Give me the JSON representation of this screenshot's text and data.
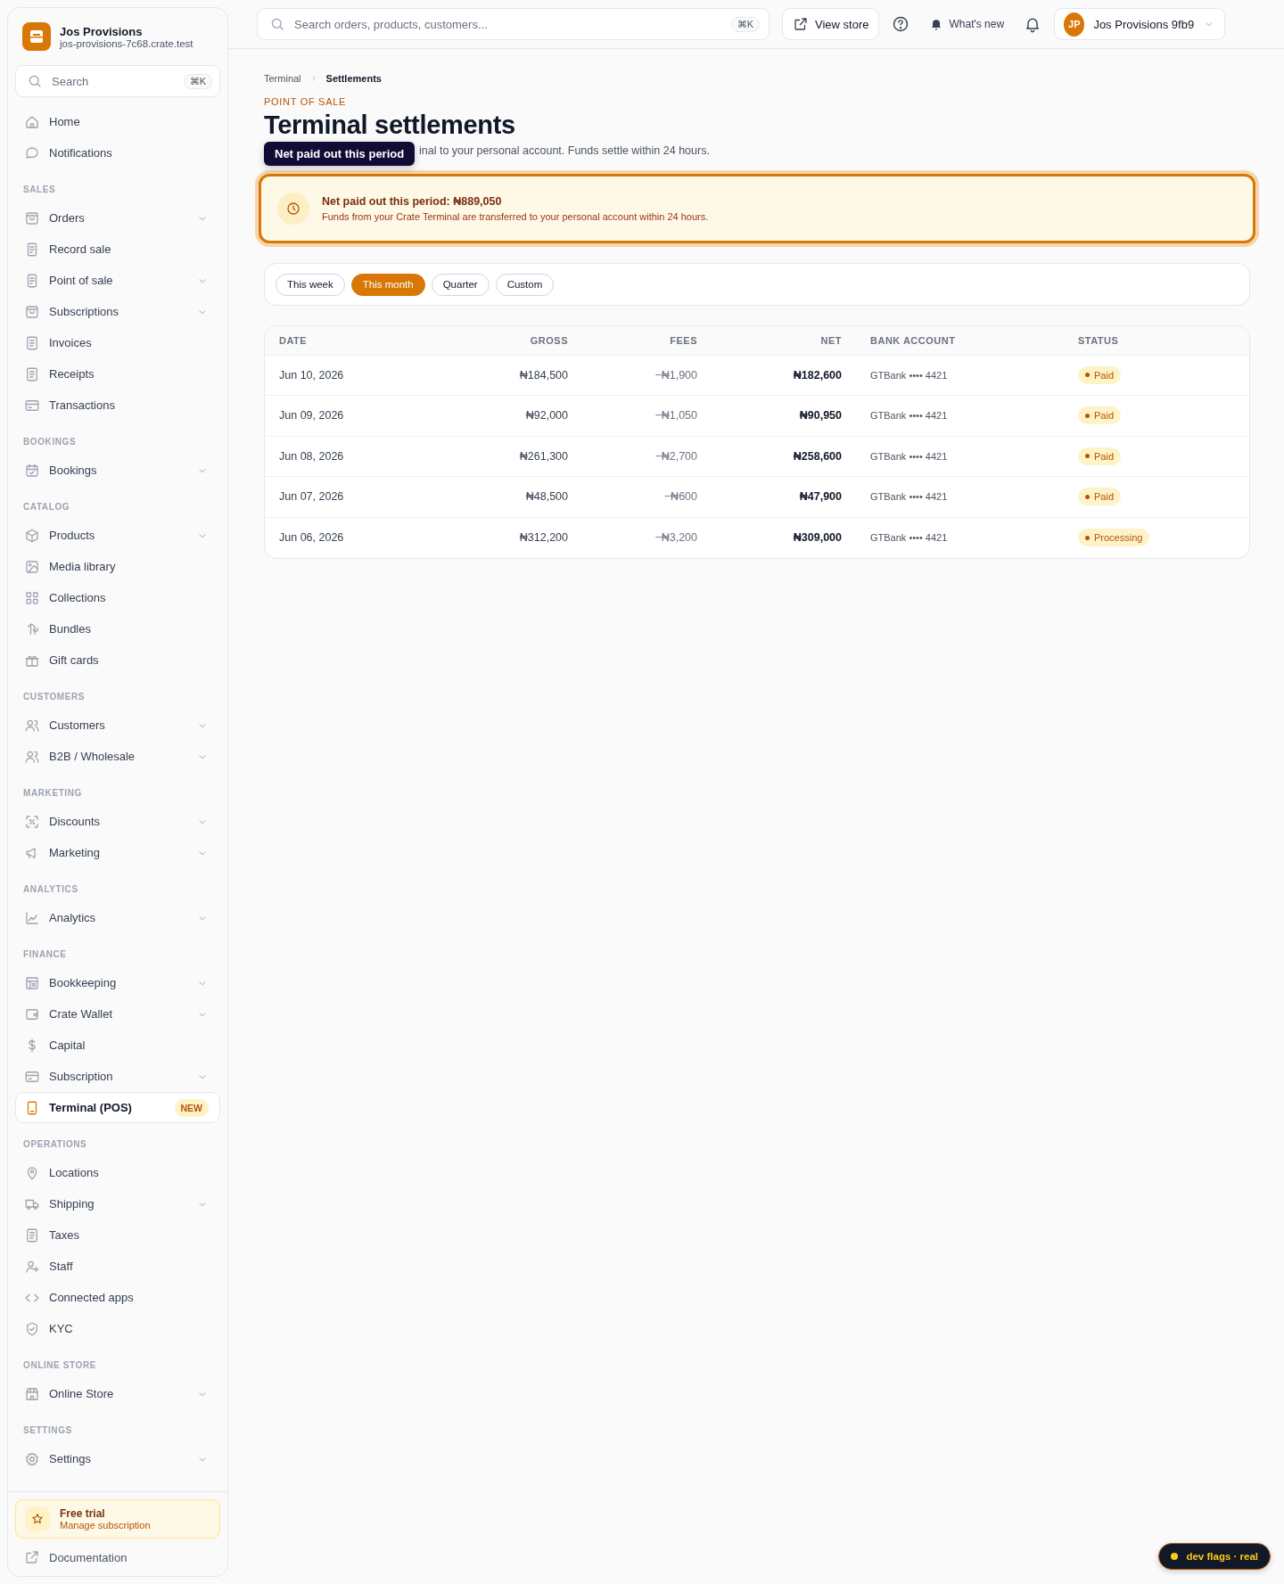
{
  "brand": {
    "name": "Jos Provisions",
    "domain": "jos-provisions-7c68.crate.test"
  },
  "sidebar_search": {
    "placeholder": "Search",
    "shortcut": "⌘K"
  },
  "sidebar": {
    "sections": [
      {
        "items": [
          {
            "label": "Home",
            "expandable": false,
            "selected": false
          },
          {
            "label": "Notifications",
            "expandable": false,
            "selected": false
          }
        ]
      },
      {
        "label": "SALES",
        "items": [
          {
            "label": "Orders",
            "expandable": true,
            "selected": false
          },
          {
            "label": "Record sale",
            "expandable": false,
            "selected": false
          },
          {
            "label": "Point of sale",
            "expandable": true,
            "selected": false
          },
          {
            "label": "Subscriptions",
            "expandable": true,
            "selected": false
          },
          {
            "label": "Invoices",
            "expandable": false,
            "selected": false
          },
          {
            "label": "Receipts",
            "expandable": false,
            "selected": false
          },
          {
            "label": "Transactions",
            "expandable": false,
            "selected": false
          }
        ]
      },
      {
        "label": "BOOKINGS",
        "items": [
          {
            "label": "Bookings",
            "expandable": true,
            "selected": false
          }
        ]
      },
      {
        "label": "CATALOG",
        "items": [
          {
            "label": "Products",
            "expandable": true,
            "selected": false
          },
          {
            "label": "Media library",
            "expandable": false,
            "selected": false
          },
          {
            "label": "Collections",
            "expandable": false,
            "selected": false
          },
          {
            "label": "Bundles",
            "expandable": false,
            "selected": false
          },
          {
            "label": "Gift cards",
            "expandable": false,
            "selected": false
          }
        ]
      },
      {
        "label": "CUSTOMERS",
        "items": [
          {
            "label": "Customers",
            "expandable": true,
            "selected": false
          },
          {
            "label": "B2B / Wholesale",
            "expandable": true,
            "selected": false
          }
        ]
      },
      {
        "label": "MARKETING",
        "items": [
          {
            "label": "Discounts",
            "expandable": true,
            "selected": false
          },
          {
            "label": "Marketing",
            "expandable": true,
            "selected": false
          }
        ]
      },
      {
        "label": "ANALYTICS",
        "items": [
          {
            "label": "Analytics",
            "expandable": true,
            "selected": false
          }
        ]
      },
      {
        "label": "FINANCE",
        "items": [
          {
            "label": "Bookkeeping",
            "expandable": true,
            "selected": false
          },
          {
            "label": "Crate Wallet",
            "expandable": true,
            "selected": false
          },
          {
            "label": "Capital",
            "expandable": false,
            "selected": false
          },
          {
            "label": "Subscription",
            "expandable": true,
            "selected": false
          },
          {
            "label": "Terminal (POS)",
            "expandable": false,
            "selected": true,
            "badge": "NEW"
          }
        ]
      },
      {
        "label": "OPERATIONS",
        "items": [
          {
            "label": "Locations",
            "expandable": false,
            "selected": false
          },
          {
            "label": "Shipping",
            "expandable": true,
            "selected": false
          },
          {
            "label": "Taxes",
            "expandable": false,
            "selected": false
          },
          {
            "label": "Staff",
            "expandable": false,
            "selected": false
          },
          {
            "label": "Connected apps",
            "expandable": false,
            "selected": false
          },
          {
            "label": "KYC",
            "expandable": false,
            "selected": false
          }
        ]
      },
      {
        "label": "ONLINE STORE",
        "items": [
          {
            "label": "Online Store",
            "expandable": true,
            "selected": false
          }
        ]
      },
      {
        "label": "SETTINGS",
        "items": [
          {
            "label": "Settings",
            "expandable": true,
            "selected": false
          }
        ]
      }
    ],
    "trial": {
      "title": "Free trial",
      "link": "Manage subscription"
    },
    "documentation": "Documentation"
  },
  "topbar": {
    "search": {
      "placeholder": "Search orders, products, customers...",
      "shortcut": "⌘K"
    },
    "view_store": "View store",
    "whats_new": "What's new",
    "account": {
      "initials": "JP",
      "name": "Jos Provisions 9fb9"
    }
  },
  "breadcrumb": [
    {
      "label": "Terminal",
      "current": false
    },
    {
      "label": "Settlements",
      "current": true
    }
  ],
  "eyebrow": "POINT OF SALE",
  "title": "Terminal settlements",
  "subtitle": "inal to your personal account. Funds settle within 24 hours.",
  "tooltip": "Net paid out this period",
  "alert": {
    "title": "Net paid out this period: ₦889,050",
    "text": "Funds from your Crate Terminal are transferred to your personal account within 24 hours.",
    "highlighted": true
  },
  "filters": [
    {
      "label": "This week",
      "selected": false
    },
    {
      "label": "This month",
      "selected": true
    },
    {
      "label": "Quarter",
      "selected": false
    },
    {
      "label": "Custom",
      "selected": false
    }
  ],
  "table": {
    "columns": [
      "DATE",
      "GROSS",
      "FEES",
      "NET",
      "BANK ACCOUNT",
      "STATUS"
    ],
    "rows": [
      [
        "Jun 10, 2026",
        "₦184,500",
        "−₦1,900",
        "₦182,600",
        "GTBank •••• 4421",
        "Paid"
      ],
      [
        "Jun 09, 2026",
        "₦92,000",
        "−₦1,050",
        "₦90,950",
        "GTBank •••• 4421",
        "Paid"
      ],
      [
        "Jun 08, 2026",
        "₦261,300",
        "−₦2,700",
        "₦258,600",
        "GTBank •••• 4421",
        "Paid"
      ],
      [
        "Jun 07, 2026",
        "₦48,500",
        "−₦600",
        "₦47,900",
        "GTBank •••• 4421",
        "Paid"
      ],
      [
        "Jun 06, 2026",
        "₦312,200",
        "−₦3,200",
        "₦309,000",
        "GTBank •••• 4421",
        "Processing"
      ]
    ]
  },
  "dev_flags": "dev flags · real"
}
